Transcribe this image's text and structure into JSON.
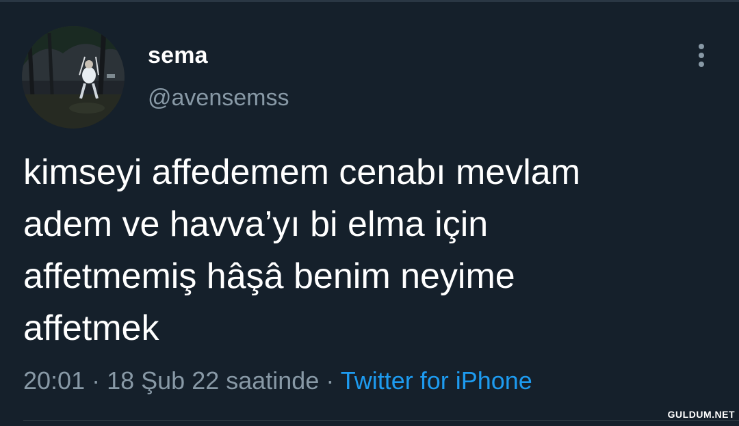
{
  "tweet": {
    "author": {
      "display_name": "sema",
      "handle": "@avensemss"
    },
    "text_lines": [
      "kimseyi affedemem cenabı mevlam",
      "adem ve havva’yı bi elma için",
      "affetmemiş hâşâ benim neyime",
      "affetmek"
    ],
    "meta": {
      "time": "20:01",
      "separator": " · ",
      "date": "18 Şub 22 saatinde",
      "source": "Twitter for iPhone"
    }
  },
  "watermark": "GULDUM.NET",
  "colors": {
    "background": "#15202b",
    "primary_text": "#ffffff",
    "secondary_text": "#8899a6",
    "link": "#1d9bf0"
  },
  "icons": {
    "more_menu": "more-vertical-icon"
  }
}
